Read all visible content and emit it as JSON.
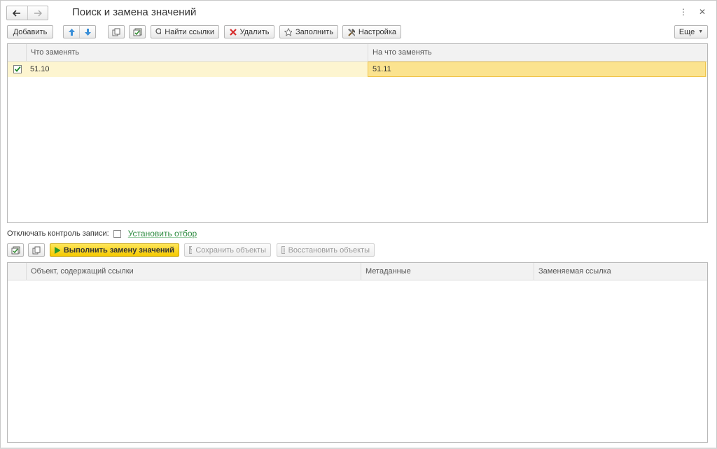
{
  "window": {
    "title": "Поиск и замена значений"
  },
  "toolbar": {
    "add_label": "Добавить",
    "find_refs_label": "Найти ссылки",
    "delete_label": "Удалить",
    "fill_label": "Заполнить",
    "settings_label": "Настройка",
    "more_label": "Еще"
  },
  "replace_table": {
    "columns": [
      "Что заменять",
      "На что заменять"
    ],
    "rows": [
      {
        "checked": true,
        "what": "51.10",
        "with": "51.11"
      }
    ]
  },
  "options": {
    "disable_control_label": "Отключать контроль записи:",
    "set_filter_label": "Установить отбор"
  },
  "actions": {
    "run_label": "Выполнить замену значений",
    "save_label": "Сохранить объекты",
    "restore_label": "Восстановить объекты"
  },
  "results_table": {
    "columns": [
      "Объект, содержащий ссылки",
      "Метаданные",
      "Заменяемая ссылка"
    ]
  },
  "colors": {
    "row_highlight": "#fdf5d0",
    "active_cell": "#fbe38f",
    "primary": "#f5c900",
    "link": "#2b8a3e"
  }
}
